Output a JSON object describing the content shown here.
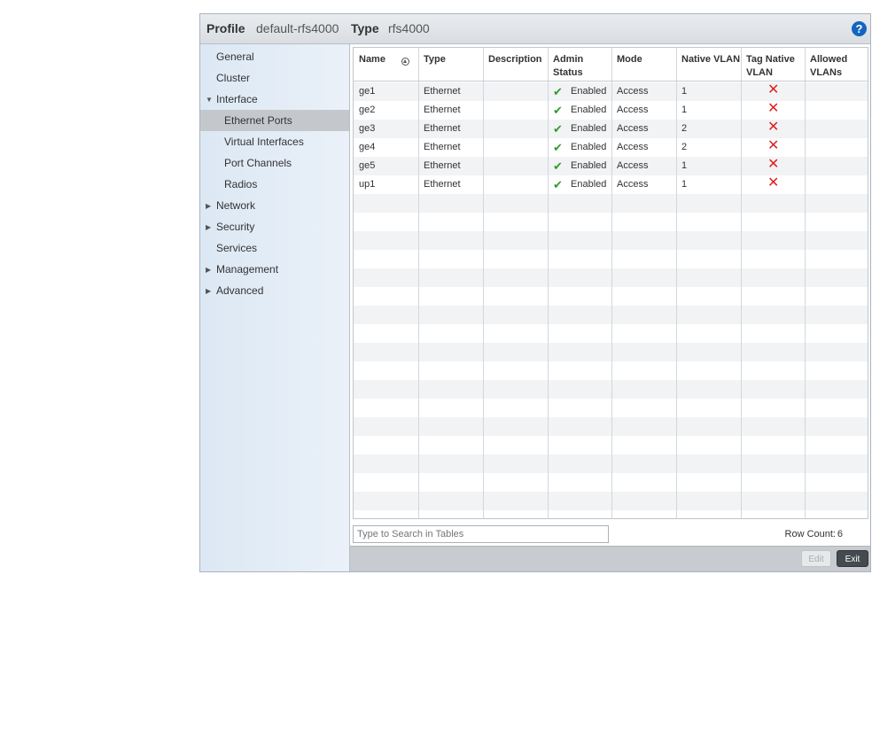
{
  "header": {
    "profile_label": "Profile",
    "profile_value": "default-rfs4000",
    "type_label": "Type",
    "type_value": "rfs4000",
    "help_icon": "?"
  },
  "sidebar": {
    "items": [
      {
        "label": "General",
        "expander": ""
      },
      {
        "label": "Cluster",
        "expander": ""
      },
      {
        "label": "Interface",
        "expander": "▼"
      },
      {
        "label": "Ethernet Ports",
        "expander": "",
        "child": true,
        "selected": true
      },
      {
        "label": "Virtual Interfaces",
        "expander": "",
        "child": true
      },
      {
        "label": "Port Channels",
        "expander": "",
        "child": true
      },
      {
        "label": "Radios",
        "expander": "",
        "child": true
      },
      {
        "label": "Network",
        "expander": "▶"
      },
      {
        "label": "Security",
        "expander": "▶"
      },
      {
        "label": "Services",
        "expander": ""
      },
      {
        "label": "Management",
        "expander": "▶"
      },
      {
        "label": "Advanced",
        "expander": "▶"
      }
    ]
  },
  "table": {
    "columns": [
      "Name",
      "Type",
      "Description",
      "Admin Status",
      "Mode",
      "Native VLAN",
      "Tag Native VLAN",
      "Allowed VLANs"
    ],
    "column_lines": [
      [
        "Name"
      ],
      [
        "Type"
      ],
      [
        "Description"
      ],
      [
        "Admin",
        "Status"
      ],
      [
        "Mode"
      ],
      [
        "Native VLAN"
      ],
      [
        "Tag Native",
        "VLAN"
      ],
      [
        "Allowed",
        "VLANs"
      ]
    ],
    "sort_icon": "sort-ascending-icon",
    "rows": [
      {
        "name": "ge1",
        "type": "Ethernet",
        "description": "",
        "admin_status": "Enabled",
        "mode": "Access",
        "native_vlan": "1",
        "tag_native_vlan": false,
        "allowed_vlans": ""
      },
      {
        "name": "ge2",
        "type": "Ethernet",
        "description": "",
        "admin_status": "Enabled",
        "mode": "Access",
        "native_vlan": "1",
        "tag_native_vlan": false,
        "allowed_vlans": ""
      },
      {
        "name": "ge3",
        "type": "Ethernet",
        "description": "",
        "admin_status": "Enabled",
        "mode": "Access",
        "native_vlan": "2",
        "tag_native_vlan": false,
        "allowed_vlans": ""
      },
      {
        "name": "ge4",
        "type": "Ethernet",
        "description": "",
        "admin_status": "Enabled",
        "mode": "Access",
        "native_vlan": "2",
        "tag_native_vlan": false,
        "allowed_vlans": ""
      },
      {
        "name": "ge5",
        "type": "Ethernet",
        "description": "",
        "admin_status": "Enabled",
        "mode": "Access",
        "native_vlan": "1",
        "tag_native_vlan": false,
        "allowed_vlans": ""
      },
      {
        "name": "up1",
        "type": "Ethernet",
        "description": "",
        "admin_status": "Enabled",
        "mode": "Access",
        "native_vlan": "1",
        "tag_native_vlan": false,
        "allowed_vlans": ""
      }
    ]
  },
  "footer": {
    "search_placeholder": "Type to Search in Tables",
    "row_count_label": "Row Count:",
    "row_count_value": "6"
  },
  "buttons": {
    "edit": "Edit",
    "exit": "Exit"
  },
  "colors": {
    "enabled_check": "#2e9c2a",
    "tag_native_false": "#e02020",
    "help_icon": "#1565c0",
    "selected_nav": "#c4c8cd"
  }
}
